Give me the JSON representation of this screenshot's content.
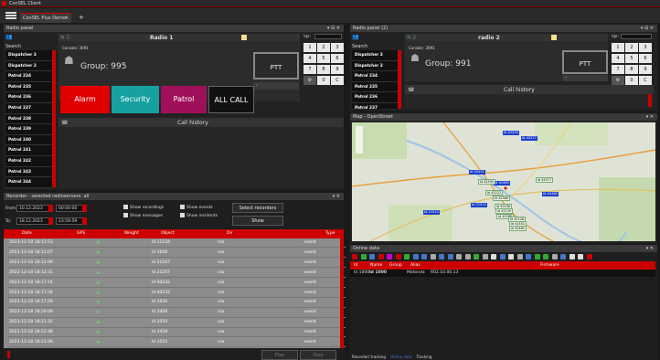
{
  "window": {
    "title": "ConSEL Client",
    "tab": "ConSEL Plus Demo",
    "tab_add": "+"
  },
  "radio1": {
    "panel_title": "Radio panel",
    "search": "Search",
    "header": "Radio 1",
    "console": "Console: 3091",
    "group": "Group: 995",
    "ptt": "PTT",
    "dispatchers": [
      "Dispatcher 3",
      "Dispatcher 2",
      "Patrol 234",
      "Patrol 235",
      "Patrol 236",
      "Patrol 237",
      "Patrol 238",
      "Patrol 239",
      "Patrol 240",
      "Patrol 241",
      "Patrol 242",
      "Patrol 243",
      "Patrol 244"
    ],
    "buttons": [
      "Alarm",
      "Security",
      "Patrol",
      "ALL CALL"
    ],
    "call_history": "Call history",
    "vpr": "Vpr:",
    "keys": [
      "1",
      "2",
      "3",
      "4",
      "5",
      "6",
      "7",
      "8",
      "9",
      "0",
      "C"
    ]
  },
  "radio2": {
    "panel_title": "Radio panel (2)",
    "search": "Search",
    "header": "radio 2",
    "console": "Console: 3091",
    "group": "Group: 991",
    "ptt": "PTT",
    "dispatchers": [
      "Dispatcher 3",
      "Dispatcher 2",
      "Patrol 234",
      "Patrol 235",
      "Patrol 236",
      "Patrol 237"
    ],
    "call_history": "Call history",
    "vpr": "Vpr:",
    "keys": [
      "1",
      "2",
      "3",
      "4",
      "5",
      "6",
      "7",
      "8",
      "9",
      "0",
      "C"
    ]
  },
  "map": {
    "title": "Map - OpenStreet",
    "labels_blue": [
      "Id 42220",
      "Id 42577",
      "Id 42451",
      "Id 42469",
      "Id 42460",
      "Id 21513",
      "Id 21513"
    ],
    "labels_green": [
      "Id 42594",
      "Id 42577",
      "Id 42222",
      "Id 42389",
      "Id 42436",
      "Id 42129",
      "Id 42088",
      "Id 42128",
      "Id 42451",
      "Id 42462"
    ]
  },
  "recorder": {
    "title": "Recorder - selected radioservers: all",
    "from_label": "From:",
    "from_date": "10.12.2023",
    "from_time": "00:00:00",
    "to_label": "To:",
    "to_date": "18.12.2023",
    "to_time": "23:59:59",
    "show_recordings": "Show recordings",
    "show_messages": "Show messages",
    "show_events": "Show events",
    "show_incidents": "Show incidents",
    "select_recorders": "Select recorders",
    "show": "Show",
    "columns": [
      "Date",
      "GPS",
      "Weight",
      "Object",
      "Dir",
      "Type"
    ],
    "rows": [
      {
        "date": "2023-12-18 18:11:53",
        "object": "Id 21234",
        "dir": "n/a",
        "type": "event"
      },
      {
        "date": "2023-12-18 18:12:07",
        "object": "Id 1608",
        "dir": "n/a",
        "type": "event"
      },
      {
        "date": "2023-12-18 18:12:09",
        "object": "Id 21247",
        "dir": "n/a",
        "type": "event"
      },
      {
        "date": "2023-12-18 18:12:31",
        "object": "Id 21247",
        "dir": "n/a",
        "type": "event"
      },
      {
        "date": "2023-12-18 18:17:14",
        "object": "Id 94232",
        "dir": "n/a",
        "type": "event"
      },
      {
        "date": "2023-12-18 18:17:34",
        "object": "Id 94232",
        "dir": "n/a",
        "type": "event"
      },
      {
        "date": "2023-12-18 18:17:59",
        "object": "Id 2026",
        "dir": "n/a",
        "type": "event"
      },
      {
        "date": "2023-12-18 18:20:09",
        "object": "Id 3408",
        "dir": "n/a",
        "type": "event"
      },
      {
        "date": "2023-12-18 18:21:16",
        "object": "Id 2010",
        "dir": "n/a",
        "type": "event"
      },
      {
        "date": "2023-12-18 18:22:48",
        "object": "Id 3418",
        "dir": "n/a",
        "type": "event"
      },
      {
        "date": "2023-12-18 18:23:26",
        "object": "Id 1010",
        "dir": "n/a",
        "type": "event"
      }
    ],
    "play": "Play",
    "stop": "Stop"
  },
  "online": {
    "title": "Online data",
    "columns": [
      "Id",
      "Name",
      "Group",
      "Alias",
      "Firmware"
    ],
    "row": {
      "id": "Id 1000",
      "name": "Id 1000",
      "group": "",
      "alias": "Motorola",
      "firmware": "R02.10.00.13"
    },
    "bottom_tabs": [
      "Recorder/ tracking",
      "Online data",
      "Tracking"
    ]
  },
  "colors": {
    "alarm": "#e00000",
    "security": "#17a0a0",
    "patrol": "#a0105a",
    "accent_red": "#cc0000"
  }
}
